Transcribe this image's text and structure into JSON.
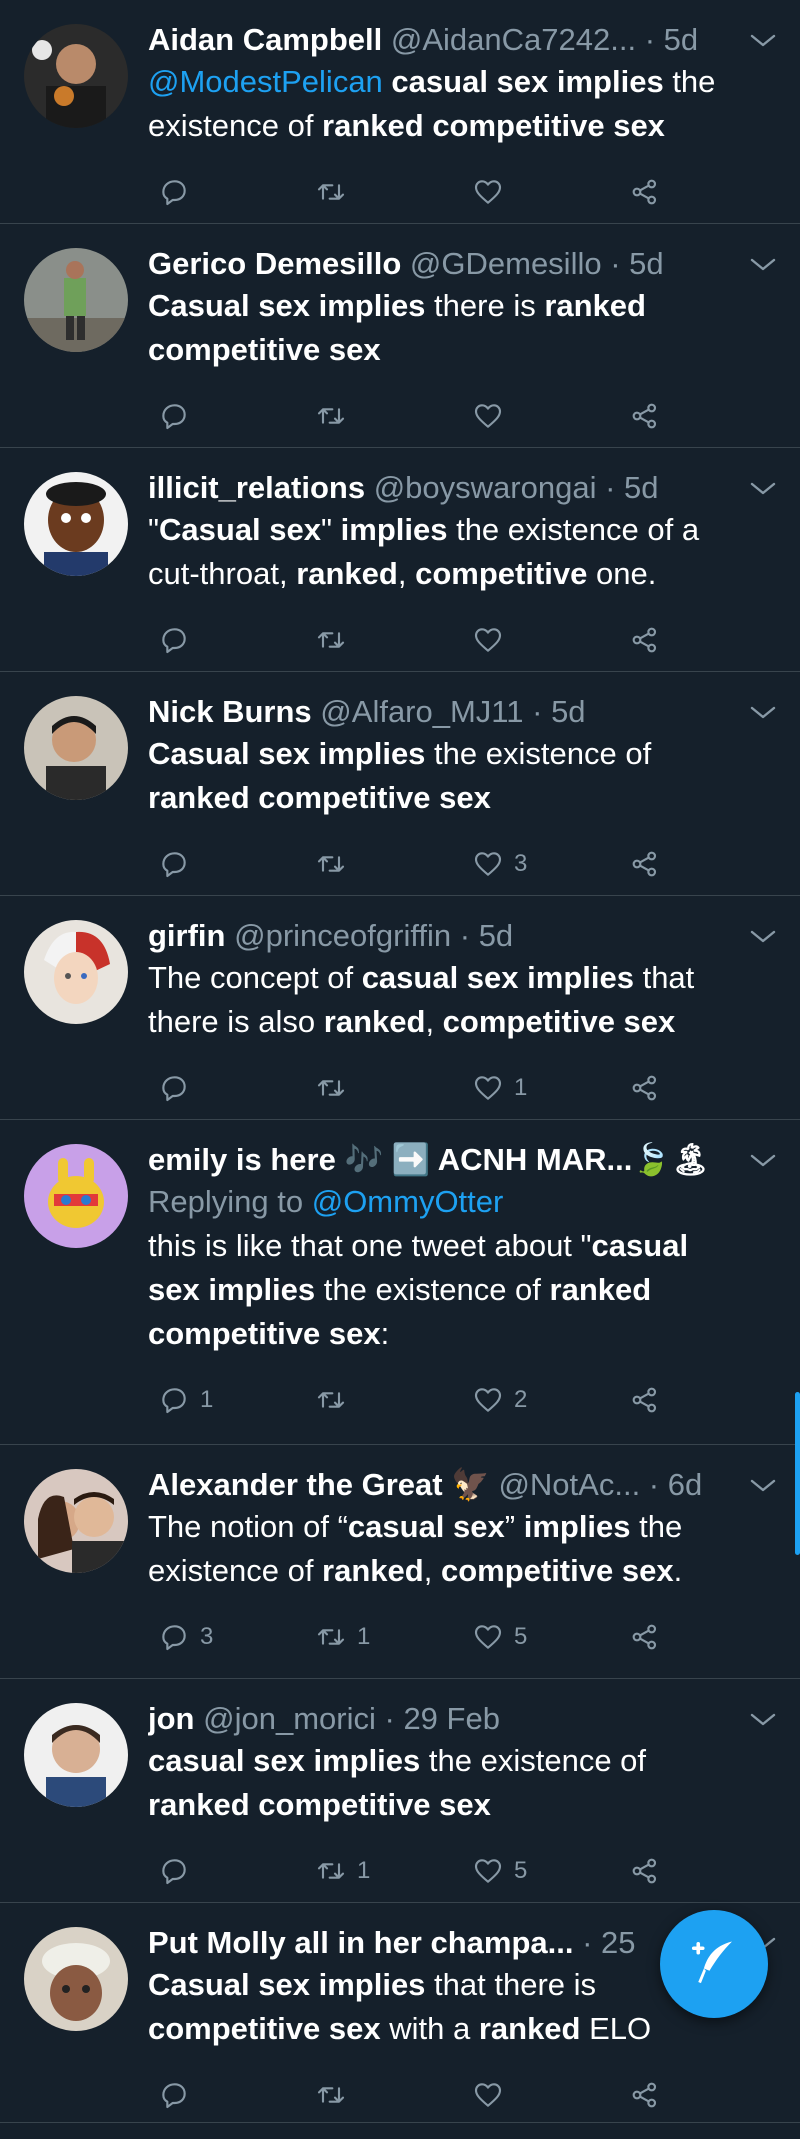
{
  "tweets": [
    {
      "name": "Aidan Campbell",
      "handle": "@AidanCa7242...",
      "time": "5d",
      "body": [
        {
          "t": "@ModestPelican ",
          "mention": true
        },
        {
          "t": "casual sex implies",
          "b": true
        },
        {
          "t": " the existence of "
        },
        {
          "t": "ranked competitive sex",
          "b": true
        }
      ],
      "reply": "",
      "retweet": "",
      "like": ""
    },
    {
      "name": "Gerico Demesillo",
      "handle": "@GDemesillo",
      "time": "5d",
      "body": [
        {
          "t": "Casual sex implies",
          "b": true
        },
        {
          "t": " there is "
        },
        {
          "t": "ranked competitive sex",
          "b": true
        }
      ],
      "reply": "",
      "retweet": "",
      "like": ""
    },
    {
      "name": "illicit_relations",
      "handle": "@boyswarongai",
      "time": "5d",
      "body": [
        {
          "t": "\""
        },
        {
          "t": "Casual sex",
          "b": true
        },
        {
          "t": "\" "
        },
        {
          "t": "implies",
          "b": true
        },
        {
          "t": " the existence of a cut-throat, "
        },
        {
          "t": "ranked",
          "b": true
        },
        {
          "t": ", "
        },
        {
          "t": "competitive",
          "b": true
        },
        {
          "t": " one."
        }
      ],
      "reply": "",
      "retweet": "",
      "like": ""
    },
    {
      "name": "Nick Burns",
      "handle": "@Alfaro_MJ11",
      "time": "5d",
      "body": [
        {
          "t": "Casual sex implies",
          "b": true
        },
        {
          "t": " the existence of "
        },
        {
          "t": "ranked competitive sex",
          "b": true
        }
      ],
      "reply": "",
      "retweet": "",
      "like": "3"
    },
    {
      "name": "girfin",
      "handle": "@princeofgriffin",
      "time": "5d",
      "body": [
        {
          "t": "The concept of "
        },
        {
          "t": "casual sex implies",
          "b": true
        },
        {
          "t": " that there is also "
        },
        {
          "t": "ranked",
          "b": true
        },
        {
          "t": ", "
        },
        {
          "t": "competitive sex",
          "b": true
        }
      ],
      "reply": "",
      "retweet": "",
      "like": "1"
    },
    {
      "name": "emily is here 🎶 ➡️ ACNH MAR...🍃🏝",
      "handle": "",
      "time": "",
      "replying_prefix": "Replying to ",
      "replying_to": "@OmmyOtter",
      "body": [
        {
          "t": "this is like that one tweet about \""
        },
        {
          "t": "casual sex implies",
          "b": true
        },
        {
          "t": " the existence of "
        },
        {
          "t": "ranked competitive sex",
          "b": true
        },
        {
          "t": ":"
        }
      ],
      "reply": "1",
      "retweet": "",
      "like": "2"
    },
    {
      "name": "Alexander the Great 🦅",
      "handle": "@NotAc...",
      "time": "6d",
      "body": [
        {
          "t": "The notion of “"
        },
        {
          "t": "casual sex",
          "b": true
        },
        {
          "t": "” "
        },
        {
          "t": "implies",
          "b": true
        },
        {
          "t": " the existence of "
        },
        {
          "t": "ranked",
          "b": true
        },
        {
          "t": ", "
        },
        {
          "t": "competitive sex",
          "b": true
        },
        {
          "t": "."
        }
      ],
      "reply": "3",
      "retweet": "1",
      "like": "5"
    },
    {
      "name": "jon",
      "handle": "@jon_morici",
      "time": "29 Feb",
      "body": [
        {
          "t": "casual sex implies",
          "b": true
        },
        {
          "t": " the existence of "
        },
        {
          "t": "ranked competitive sex",
          "b": true
        }
      ],
      "reply": "",
      "retweet": "1",
      "like": "5"
    },
    {
      "name": "Put Molly all in her champa...",
      "handle": "",
      "time": "25",
      "body": [
        {
          "t": "Casual sex implies",
          "b": true
        },
        {
          "t": " that there is "
        },
        {
          "t": "competitive sex",
          "b": true
        },
        {
          "t": " with a "
        },
        {
          "t": "ranked",
          "b": true
        },
        {
          "t": " ELO"
        }
      ],
      "reply": "",
      "retweet": "",
      "like": ""
    }
  ],
  "colors": {
    "background": "#15202b",
    "accent": "#1da1f2",
    "muted": "#8899a6",
    "divider": "#38444d"
  },
  "icons": {
    "reply": "reply-icon",
    "retweet": "retweet-icon",
    "like": "heart-icon",
    "share": "share-icon",
    "compose": "compose-tweet-icon"
  }
}
